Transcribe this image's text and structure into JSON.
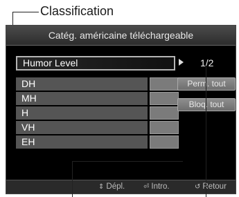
{
  "callout": {
    "label": "Classification"
  },
  "dialog": {
    "title": "Catég. américaine téléchargeable",
    "humor_level": "Humor Level",
    "page_indicator": "1/2",
    "ratings": [
      "DH",
      "MH",
      "H",
      "VH",
      "EH"
    ],
    "buttons": {
      "permit_all": "Perm. tout",
      "block_all": "Bloq. tout"
    }
  },
  "footer": {
    "move": {
      "icon": "up-down-arrows-icon",
      "label": "Dépl."
    },
    "enter": {
      "icon": "enter-icon",
      "label": "Intro."
    },
    "return": {
      "icon": "return-icon",
      "label": "Retour"
    }
  }
}
